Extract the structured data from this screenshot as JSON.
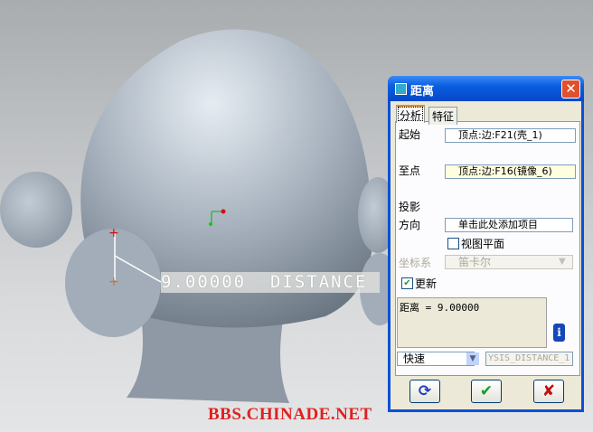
{
  "viewport": {
    "distance_label": "9.00000  DISTANCE"
  },
  "watermark": "BBS.CHINADE.NET",
  "dialog": {
    "title": "距离",
    "tabs": [
      {
        "label": "分析",
        "active": true
      },
      {
        "label": "特征",
        "active": false
      }
    ],
    "from_label": "起始",
    "from_value": "顶点:边:F21(壳_1)",
    "to_label": "至点",
    "to_value": "顶点:边:F16(镜像_6)",
    "projection_label": "投影",
    "direction_label": "方向",
    "direction_value": "单击此处添加项目",
    "view_plane_label": "视图平面",
    "view_plane_checked": false,
    "csys_label": "坐标系",
    "csys_value": "笛卡尔",
    "update_label": "更新",
    "update_checked": true,
    "result_text": "距离 = 9.00000",
    "mode_value": "快速",
    "feature_name": "YSIS_DISTANCE_1",
    "icons": {
      "info": "info-icon",
      "repeat": "repeat-icon",
      "ok": "check-icon",
      "cancel": "x-icon"
    },
    "colors": {
      "title_bar": "#0a5de0",
      "highlight_field": "#ffffe0"
    }
  }
}
